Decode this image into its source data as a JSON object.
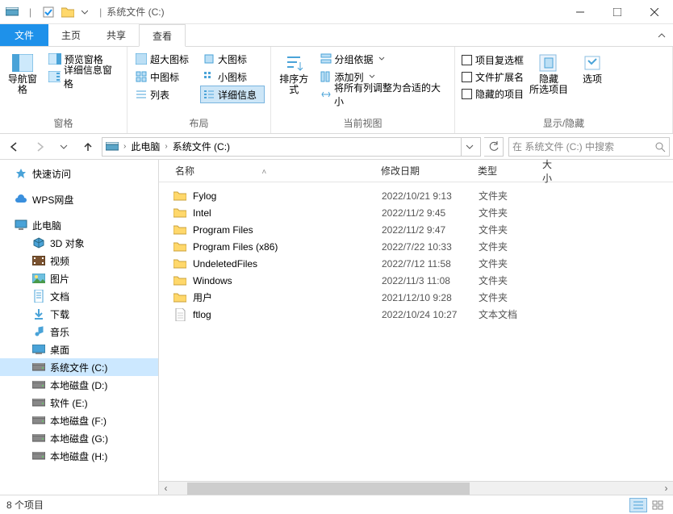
{
  "title": "系统文件 (C:)",
  "tabs": {
    "file": "文件",
    "home": "主页",
    "share": "共享",
    "view": "查看"
  },
  "ribbon": {
    "pane": {
      "nav": "导航窗格",
      "preview": "预览窗格",
      "details": "详细信息窗格",
      "group": "窗格"
    },
    "layout": {
      "xl": "超大图标",
      "l": "大图标",
      "m": "中图标",
      "s": "小图标",
      "list": "列表",
      "det": "详细信息",
      "group": "布局"
    },
    "view": {
      "sort": "排序方式",
      "groupby": "分组依据",
      "addcol": "添加列",
      "autofit": "将所有列调整为合适的大小",
      "group": "当前视图"
    },
    "showhide": {
      "chk1": "项目复选框",
      "chk2": "文件扩展名",
      "chk3": "隐藏的项目",
      "hide": "隐藏\n所选项目",
      "options": "选项",
      "group": "显示/隐藏"
    }
  },
  "address": {
    "pc": "此电脑",
    "loc": "系统文件 (C:)",
    "search_placeholder": "在 系统文件 (C:) 中搜索"
  },
  "sidebar": {
    "quick": "快速访问",
    "wps": "WPS网盘",
    "pc": "此电脑",
    "pc_children": [
      {
        "icon": "3d",
        "label": "3D 对象"
      },
      {
        "icon": "video",
        "label": "视频"
      },
      {
        "icon": "pic",
        "label": "图片"
      },
      {
        "icon": "doc",
        "label": "文档"
      },
      {
        "icon": "dl",
        "label": "下载"
      },
      {
        "icon": "music",
        "label": "音乐"
      },
      {
        "icon": "desk",
        "label": "桌面"
      },
      {
        "icon": "drive",
        "label": "系统文件 (C:)",
        "selected": true
      },
      {
        "icon": "drive",
        "label": "本地磁盘 (D:)"
      },
      {
        "icon": "drive",
        "label": "软件 (E:)"
      },
      {
        "icon": "drive",
        "label": "本地磁盘 (F:)"
      },
      {
        "icon": "drive",
        "label": "本地磁盘 (G:)"
      },
      {
        "icon": "drive",
        "label": "本地磁盘 (H:)"
      }
    ]
  },
  "columns": {
    "name": "名称",
    "date": "修改日期",
    "type": "类型",
    "size": "大小"
  },
  "files": [
    {
      "icon": "folder",
      "name": "Fylog",
      "date": "2022/10/21 9:13",
      "type": "文件夹"
    },
    {
      "icon": "folder",
      "name": "Intel",
      "date": "2022/11/2 9:45",
      "type": "文件夹"
    },
    {
      "icon": "folder",
      "name": "Program Files",
      "date": "2022/11/2 9:47",
      "type": "文件夹"
    },
    {
      "icon": "folder",
      "name": "Program Files (x86)",
      "date": "2022/7/22 10:33",
      "type": "文件夹"
    },
    {
      "icon": "folder",
      "name": "UndeletedFiles",
      "date": "2022/7/12 11:58",
      "type": "文件夹"
    },
    {
      "icon": "folder",
      "name": "Windows",
      "date": "2022/11/3 11:08",
      "type": "文件夹"
    },
    {
      "icon": "folder",
      "name": "用户",
      "date": "2021/12/10 9:28",
      "type": "文件夹"
    },
    {
      "icon": "file",
      "name": "ftlog",
      "date": "2022/10/24 10:27",
      "type": "文本文档"
    }
  ],
  "status": "8 个项目"
}
